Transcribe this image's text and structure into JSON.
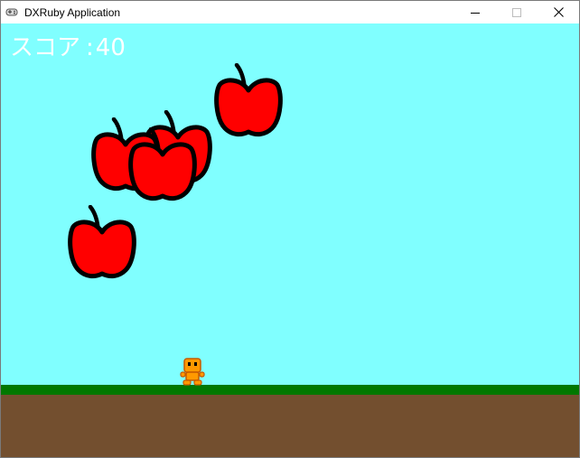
{
  "window": {
    "title": "DXRuby Application",
    "controls": [
      "minimize",
      "maximize",
      "close"
    ]
  },
  "hud": {
    "score_label": "スコア",
    "score_separator": ":",
    "score_value": "40"
  },
  "colors": {
    "sky": "#80ffff",
    "grass": "#007800",
    "ground": "#734f2f",
    "apple": "#ff0000",
    "outline": "#000000",
    "player": "#ff9900",
    "score_text": "#ffffff"
  },
  "sprites": {
    "apple_count": 5,
    "player": "orange-robot"
  }
}
